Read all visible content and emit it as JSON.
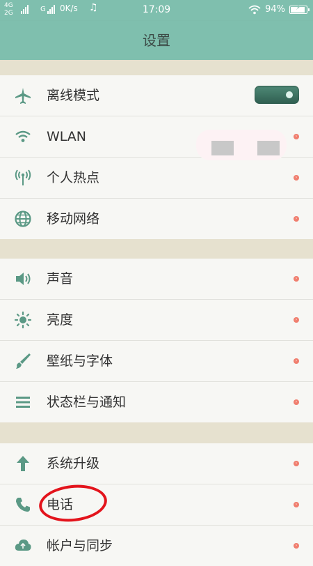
{
  "status_bar": {
    "net_top": "4G",
    "net_bottom": "2G",
    "net_g": "G",
    "speed": "0K/s",
    "time": "17:09",
    "battery": "94%",
    "battery_level": 0.94
  },
  "title": "设置",
  "groups": [
    {
      "items": [
        {
          "label": "离线模式",
          "icon": "airplane-icon"
        },
        {
          "label": "WLAN",
          "icon": "wifi-icon"
        },
        {
          "label": "个人热点",
          "icon": "hotspot-icon"
        },
        {
          "label": "移动网络",
          "icon": "globe-icon"
        }
      ]
    },
    {
      "items": [
        {
          "label": "声音",
          "icon": "speaker-icon"
        },
        {
          "label": "亮度",
          "icon": "brightness-icon"
        },
        {
          "label": "壁纸与字体",
          "icon": "brush-icon"
        },
        {
          "label": "状态栏与通知",
          "icon": "list-icon"
        }
      ]
    },
    {
      "items": [
        {
          "label": "系统升级",
          "icon": "arrow-up-icon"
        },
        {
          "label": "电话",
          "icon": "phone-icon"
        },
        {
          "label": "帐户与同步",
          "icon": "cloud-sync-icon"
        }
      ]
    }
  ],
  "colors": {
    "accent": "#7fbfae",
    "icon": "#5b9985",
    "chevron": "#f07e6e",
    "highlight_circle": "#e3141c"
  }
}
